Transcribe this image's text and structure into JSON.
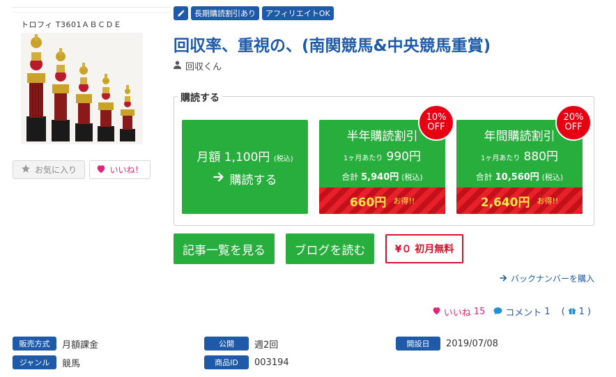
{
  "product": {
    "caption": "トロフィ T3601ＡＢＣＤＥ",
    "fav_label": "お気に入り",
    "like_label": "いいね！"
  },
  "tags": [
    "長期購読割引あり",
    "アフィリエイトOK"
  ],
  "title": "回収率、重視の、(南関競馬&中央競馬重賞)",
  "author": "回収くん",
  "subscribe": {
    "legend": "購読する",
    "monthly": {
      "price_line": "月額 1,100円",
      "tax": "(税込)",
      "action": "購読する"
    },
    "half": {
      "name": "半年購読割引",
      "per_month_label": "1ヶ月あたり",
      "per_month": "990円",
      "total_label": "合計",
      "total": "5,940円",
      "tax": "(税込)",
      "save": "660円",
      "otoku": "お得!!",
      "badge_pct": "10%",
      "badge_off": "OFF"
    },
    "year": {
      "name": "年間購読割引",
      "per_month_label": "1ヶ月あたり",
      "per_month": "880円",
      "total_label": "合計",
      "total": "10,560円",
      "tax": "(税込)",
      "save": "2,640円",
      "otoku": "お得!!",
      "badge_pct": "20%",
      "badge_off": "OFF"
    }
  },
  "buttons": {
    "articles": "記事一覧を見る",
    "blog": "ブログを読む",
    "free": "¥０ 初月無料"
  },
  "backnumber": "バックナンバーを購入",
  "stats": {
    "likes_label": "いいね",
    "likes": "15",
    "comments_label": "コメント",
    "comments": "1",
    "gifts_open": "(",
    "gifts": "1",
    "gifts_close": ")"
  },
  "meta": {
    "sales_label": "販売方式",
    "sales": "月額課金",
    "genre_label": "ジャンル",
    "genre": "競馬",
    "publish_label": "公開",
    "publish": "週2回",
    "product_id_label": "商品ID",
    "product_id": "003194",
    "open_date_label": "開設日",
    "open_date": "2019/07/08"
  },
  "colors": {
    "brand_blue": "#1e5aa8",
    "green": "#27ae3c",
    "red": "#e60012",
    "like_pink": "#e3247a"
  }
}
